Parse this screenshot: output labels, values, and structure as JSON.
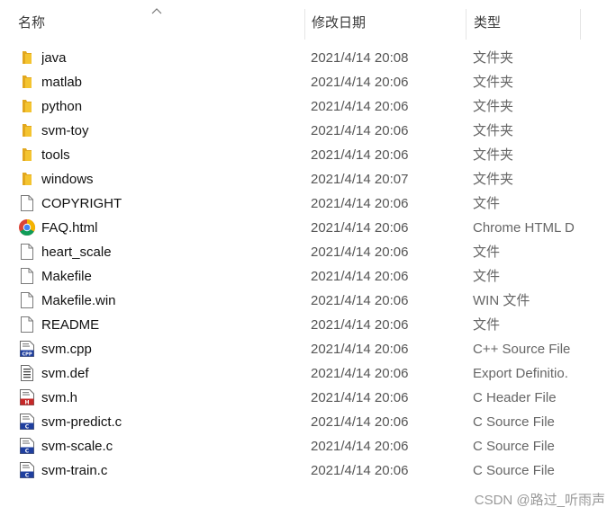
{
  "columns": {
    "name": "名称",
    "date": "修改日期",
    "type": "类型"
  },
  "files": [
    {
      "name": "java",
      "date": "2021/4/14 20:08",
      "type": "文件夹",
      "icon": "folder-icon"
    },
    {
      "name": "matlab",
      "date": "2021/4/14 20:06",
      "type": "文件夹",
      "icon": "folder-icon"
    },
    {
      "name": "python",
      "date": "2021/4/14 20:06",
      "type": "文件夹",
      "icon": "folder-icon"
    },
    {
      "name": "svm-toy",
      "date": "2021/4/14 20:06",
      "type": "文件夹",
      "icon": "folder-icon"
    },
    {
      "name": "tools",
      "date": "2021/4/14 20:06",
      "type": "文件夹",
      "icon": "folder-icon"
    },
    {
      "name": "windows",
      "date": "2021/4/14 20:07",
      "type": "文件夹",
      "icon": "folder-icon"
    },
    {
      "name": "COPYRIGHT",
      "date": "2021/4/14 20:06",
      "type": "文件",
      "icon": "file-icon"
    },
    {
      "name": "FAQ.html",
      "date": "2021/4/14 20:06",
      "type": "Chrome HTML D",
      "icon": "chrome-html-icon"
    },
    {
      "name": "heart_scale",
      "date": "2021/4/14 20:06",
      "type": "文件",
      "icon": "file-icon"
    },
    {
      "name": "Makefile",
      "date": "2021/4/14 20:06",
      "type": "文件",
      "icon": "file-icon"
    },
    {
      "name": "Makefile.win",
      "date": "2021/4/14 20:06",
      "type": "WIN 文件",
      "icon": "file-icon"
    },
    {
      "name": "README",
      "date": "2021/4/14 20:06",
      "type": "文件",
      "icon": "file-icon"
    },
    {
      "name": "svm.cpp",
      "date": "2021/4/14 20:06",
      "type": "C++ Source File",
      "icon": "cpp-file-icon"
    },
    {
      "name": "svm.def",
      "date": "2021/4/14 20:06",
      "type": "Export Definitio.",
      "icon": "def-file-icon"
    },
    {
      "name": "svm.h",
      "date": "2021/4/14 20:06",
      "type": "C Header File",
      "icon": "h-file-icon"
    },
    {
      "name": "svm-predict.c",
      "date": "2021/4/14 20:06",
      "type": "C Source File",
      "icon": "c-file-icon"
    },
    {
      "name": "svm-scale.c",
      "date": "2021/4/14 20:06",
      "type": "C Source File",
      "icon": "c-file-icon"
    },
    {
      "name": "svm-train.c",
      "date": "2021/4/14 20:06",
      "type": "C Source File",
      "icon": "c-file-icon"
    }
  ],
  "icon_badges": {
    "cpp": "CPP",
    "h": "H",
    "c": "C"
  },
  "watermark": "CSDN @路过_听雨声",
  "colors": {
    "folder": "#f4c430",
    "folder_dark": "#e2a71e",
    "cpp_badge": "#1f3f9f",
    "h_badge": "#c62828",
    "c_badge": "#1f3f9f"
  }
}
